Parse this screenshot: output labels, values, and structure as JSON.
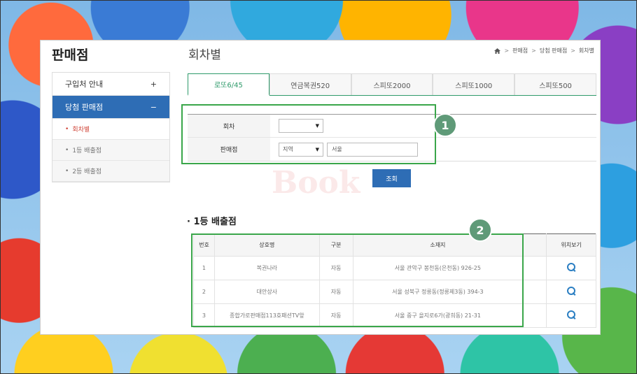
{
  "sidebar": {
    "title": "판매점",
    "items": [
      {
        "label": "구입처 안내",
        "toggle": "+"
      },
      {
        "label": "당첨 판매점",
        "toggle": "−"
      }
    ],
    "subitems": [
      {
        "bullet": "•",
        "label": "회차별"
      },
      {
        "bullet": "•",
        "label": "1등 배출점"
      },
      {
        "bullet": "•",
        "label": "2등 배출점"
      }
    ]
  },
  "header": {
    "title": "회차별",
    "breadcrumb": [
      "판매점",
      "당첨 판매점",
      "회차별"
    ]
  },
  "tabs": [
    "로또6/45",
    "연금복권520",
    "스피또2000",
    "스피또1000",
    "스피또500"
  ],
  "search": {
    "round_label": "회차",
    "round_value": "",
    "store_label": "판매점",
    "region_value": "지역",
    "city_placeholder": "서울",
    "button": "조회"
  },
  "watermark": "Book",
  "callouts": {
    "one": "1",
    "two": "2"
  },
  "results": {
    "title": "· 1등 배출점",
    "columns": [
      "번호",
      "상호명",
      "구분",
      "소재지",
      "",
      "위치보기"
    ],
    "rows": [
      {
        "no": "1",
        "name": "복권나라",
        "type": "자동",
        "address": "서울 관악구 봉천동(은천동) 926-25"
      },
      {
        "no": "2",
        "name": "대안상사",
        "type": "자동",
        "address": "서울 성북구 정릉동(정릉제3동) 394-3"
      },
      {
        "no": "3",
        "name": "종합가로판매점113호패션TV앞",
        "type": "자동",
        "address": "서울 중구 을지로6가(광희동) 21-31"
      }
    ]
  },
  "colors": {
    "accent_blue": "#2e6db5",
    "accent_green": "#2e9a6a",
    "callout": "#3aa64a"
  }
}
